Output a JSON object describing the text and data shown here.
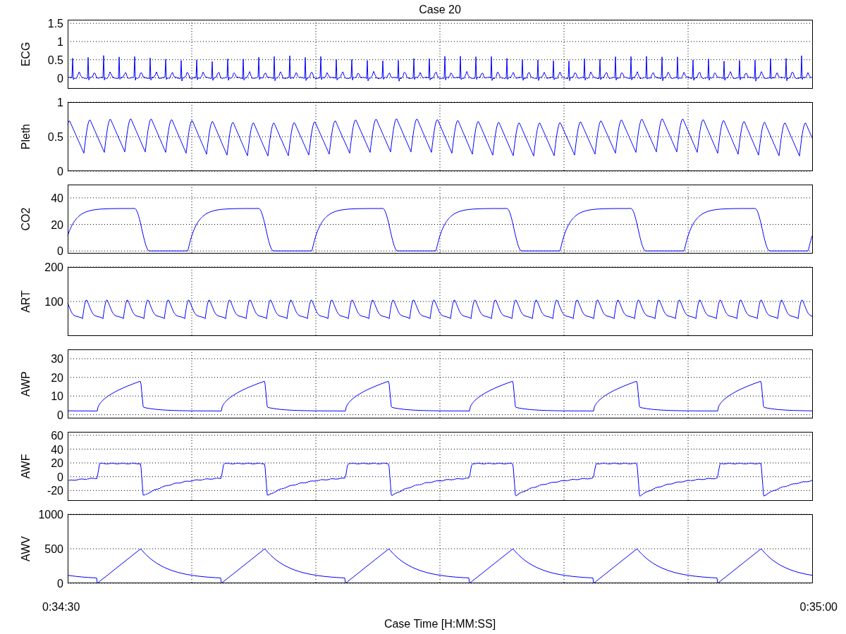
{
  "title": "Case 20",
  "panels": [
    {
      "ylabel": "ECG",
      "kind": "ecg",
      "yticks": [
        "1.5",
        "1",
        "0.5",
        "0"
      ]
    },
    {
      "ylabel": "Pleth",
      "kind": "pleth",
      "yticks": [
        "1",
        "0.5",
        "0"
      ]
    },
    {
      "ylabel": "CO2",
      "kind": "co2",
      "yticks": [
        "40",
        "20",
        "0"
      ]
    },
    {
      "ylabel": "ART",
      "kind": "art",
      "yticks": [
        "200",
        "100"
      ]
    },
    {
      "ylabel": "AWP",
      "kind": "awp",
      "yticks": [
        "30",
        "20",
        "10",
        "0"
      ]
    },
    {
      "ylabel": "AWF",
      "kind": "awf",
      "yticks": [
        "60",
        "40",
        "20",
        "0",
        "-20"
      ]
    },
    {
      "ylabel": "AWV",
      "kind": "awv",
      "yticks": [
        "1000",
        "500",
        "0"
      ]
    }
  ],
  "xticks": [
    "0:34:30",
    "0:35:00"
  ],
  "xlabel": "Case Time [H:MM:SS]"
}
